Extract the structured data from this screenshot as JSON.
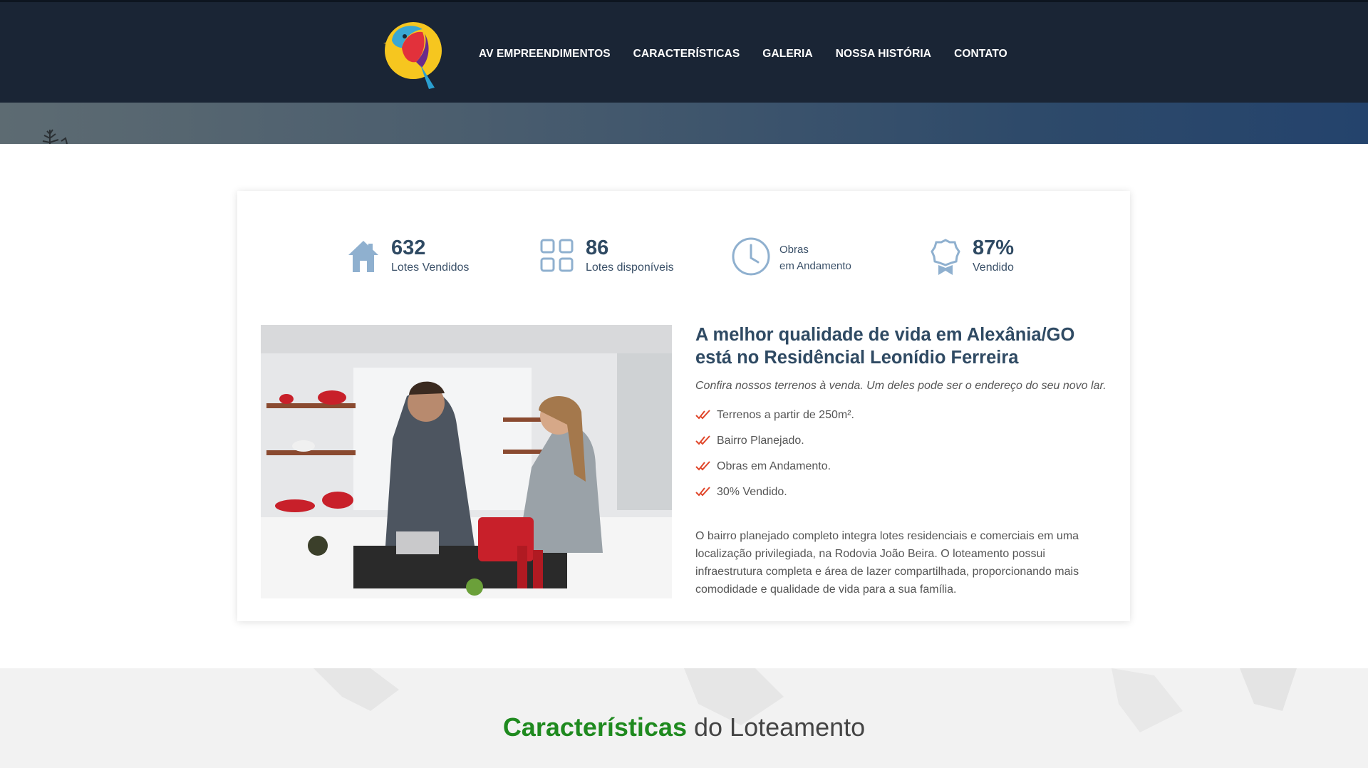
{
  "nav": {
    "items": [
      "AV EMPREENDIMENTOS",
      "CARACTERÍSTICAS",
      "GALERIA",
      "NOSSA HISTÓRIA",
      "CONTATO"
    ]
  },
  "stats": [
    {
      "icon": "house-icon",
      "number": "632",
      "label": "Lotes Vendidos"
    },
    {
      "icon": "grid-icon",
      "number": "86",
      "label": "Lotes disponíveis"
    },
    {
      "icon": "clock-icon",
      "line1": "Obras",
      "line2": "em Andamento"
    },
    {
      "icon": "award-icon",
      "number": "87%",
      "label": "Vendido"
    }
  ],
  "about": {
    "title": "A melhor qualidade de vida em Alexânia/GO está no Residêncial Leonídio Ferreira",
    "subtitle": "Confira nossos terrenos à venda. Um deles pode ser o endereço do seu novo lar.",
    "features": [
      "Terrenos a partir de 250m².",
      "Bairro Planejado.",
      "Obras em Andamento.",
      "30% Vendido."
    ],
    "description": "O bairro planejado completo integra lotes residenciais e comerciais em uma localização privilegiada, na Rodovia João Beira. O loteamento possui infraestrutura completa e área de lazer compartilhada, proporcionando mais comodidade e qualidade de vida para a sua família."
  },
  "section": {
    "highlight": "Características",
    "rest": "do Loteamento"
  },
  "colors": {
    "header": "#1a2535",
    "accent": "#2f4a63",
    "check": "#e0462a",
    "section_highlight": "#1f8a1f"
  }
}
